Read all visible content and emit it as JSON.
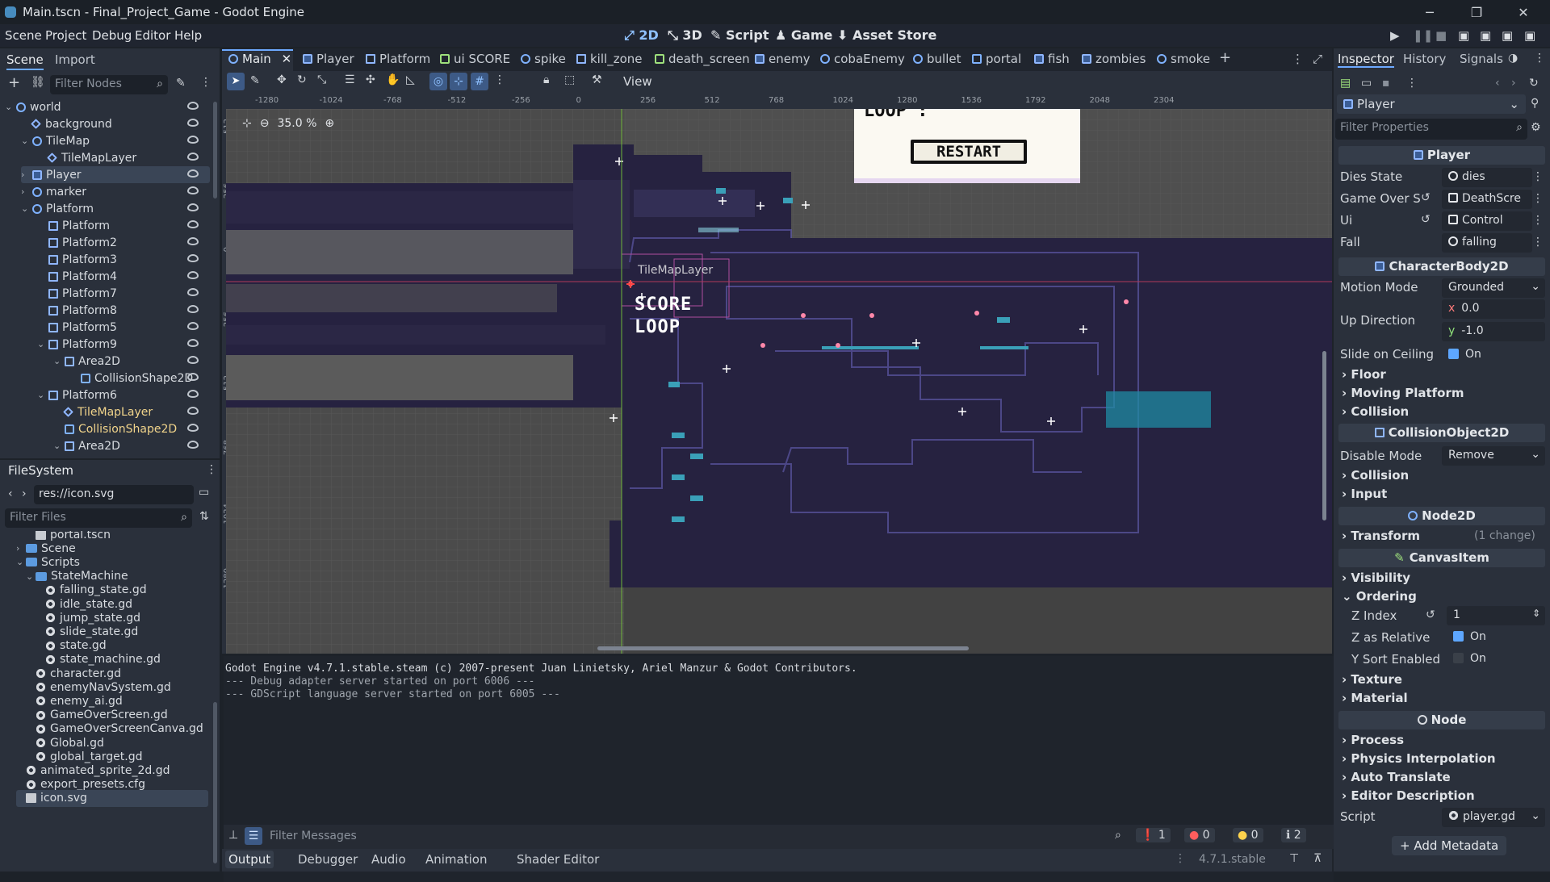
{
  "window": {
    "title": "Main.tscn - Final_Project_Game - Godot Engine"
  },
  "menus": [
    "Scene",
    "Project",
    "Debug",
    "Editor",
    "Help"
  ],
  "workspaces": [
    "2D",
    "3D",
    "Script",
    "Game",
    "Asset Store"
  ],
  "scene_dock": {
    "tabs": [
      "Scene",
      "Import"
    ],
    "filter_placeholder": "Filter Nodes",
    "nodes": [
      {
        "label": "world",
        "depth": 0,
        "icon": "node2d",
        "arrow": "v"
      },
      {
        "label": "background",
        "depth": 1,
        "icon": "tile"
      },
      {
        "label": "TileMap",
        "depth": 1,
        "icon": "node2d",
        "arrow": "v"
      },
      {
        "label": "TileMapLayer",
        "depth": 2,
        "icon": "tile"
      },
      {
        "label": "Player",
        "depth": 1,
        "icon": "char",
        "arrow": ">",
        "selected": true
      },
      {
        "label": "marker",
        "depth": 1,
        "icon": "node2d",
        "arrow": ">"
      },
      {
        "label": "Platform",
        "depth": 1,
        "icon": "node2d",
        "arrow": "v"
      },
      {
        "label": "Platform",
        "depth": 2,
        "icon": "area"
      },
      {
        "label": "Platform2",
        "depth": 2,
        "icon": "area"
      },
      {
        "label": "Platform3",
        "depth": 2,
        "icon": "area"
      },
      {
        "label": "Platform4",
        "depth": 2,
        "icon": "area"
      },
      {
        "label": "Platform7",
        "depth": 2,
        "icon": "area"
      },
      {
        "label": "Platform8",
        "depth": 2,
        "icon": "area"
      },
      {
        "label": "Platform5",
        "depth": 2,
        "icon": "area"
      },
      {
        "label": "Platform9",
        "depth": 2,
        "icon": "area",
        "arrow": "v"
      },
      {
        "label": "Area2D",
        "depth": 3,
        "icon": "area",
        "arrow": "v"
      },
      {
        "label": "CollisionShape2D",
        "depth": 4,
        "icon": "sq"
      },
      {
        "label": "Platform6",
        "depth": 2,
        "icon": "area",
        "arrow": "v"
      },
      {
        "label": "TileMapLayer",
        "depth": 3,
        "icon": "tile",
        "yellow": true
      },
      {
        "label": "CollisionShape2D",
        "depth": 3,
        "icon": "sq",
        "yellow": true
      },
      {
        "label": "Area2D",
        "depth": 3,
        "icon": "area",
        "arrow": "v"
      }
    ]
  },
  "filesystem": {
    "title": "FileSystem",
    "path": "res://icon.svg",
    "filter_placeholder": "Filter Files",
    "items": [
      {
        "label": "portal.tscn",
        "depth": 2,
        "icon": "scn"
      },
      {
        "label": "Scene",
        "depth": 1,
        "icon": "folder",
        "arrow": ">"
      },
      {
        "label": "Scripts",
        "depth": 1,
        "icon": "folder",
        "arrow": "v"
      },
      {
        "label": "StateMachine",
        "depth": 2,
        "icon": "folder",
        "arrow": "v"
      },
      {
        "label": "falling_state.gd",
        "depth": 3,
        "icon": "gear"
      },
      {
        "label": "idle_state.gd",
        "depth": 3,
        "icon": "gear"
      },
      {
        "label": "jump_state.gd",
        "depth": 3,
        "icon": "gear"
      },
      {
        "label": "slide_state.gd",
        "depth": 3,
        "icon": "gear"
      },
      {
        "label": "state.gd",
        "depth": 3,
        "icon": "gear"
      },
      {
        "label": "state_machine.gd",
        "depth": 3,
        "icon": "gear"
      },
      {
        "label": "character.gd",
        "depth": 2,
        "icon": "gear"
      },
      {
        "label": "enemyNavSystem.gd",
        "depth": 2,
        "icon": "gear"
      },
      {
        "label": "enemy_ai.gd",
        "depth": 2,
        "icon": "gear"
      },
      {
        "label": "GameOverScreen.gd",
        "depth": 2,
        "icon": "gear"
      },
      {
        "label": "GameOverScreenCanva.gd",
        "depth": 2,
        "icon": "gear"
      },
      {
        "label": "Global.gd",
        "depth": 2,
        "icon": "gear"
      },
      {
        "label": "global_target.gd",
        "depth": 2,
        "icon": "gear"
      },
      {
        "label": "animated_sprite_2d.gd",
        "depth": 1,
        "icon": "gear"
      },
      {
        "label": "export_presets.cfg",
        "depth": 1,
        "icon": "gear"
      },
      {
        "label": "icon.svg",
        "depth": 1,
        "icon": "scn",
        "selected": true
      }
    ]
  },
  "scene_tabs": [
    "Main",
    "Player",
    "Platform",
    "ui SCORE",
    "spike",
    "kill_zone",
    "death_screen",
    "enemy",
    "cobaEnemy",
    "bullet",
    "portal",
    "fish",
    "zombies",
    "smoke"
  ],
  "toolbar": {
    "view_label": "View",
    "zoom": "35.0 %"
  },
  "ruler_ticks": [
    "-1280",
    "-1024",
    "-768",
    "-512",
    "-256",
    "0",
    "256",
    "512",
    "768",
    "1024",
    "1280",
    "1536",
    "1792",
    "2048",
    "2304"
  ],
  "ruler_vticks": [
    "-512",
    "-256",
    "0",
    "256",
    "512",
    "768",
    "1024",
    "1280"
  ],
  "canvas": {
    "tilemap_label": "TileMapLayer",
    "score_label": "SCORE",
    "loop_label": "LOOP",
    "loop_top": "LOOP :",
    "restart_label": "RESTART"
  },
  "console": {
    "lines": [
      "Godot Engine v4.7.1.stable.steam (c) 2007-present Juan Linietsky, Ariel Manzur & Godot Contributors.",
      "--- Debug adapter server started on port 6006 ---",
      "--- GDScript language server started on port 6005 ---"
    ],
    "filter_placeholder": "Filter Messages",
    "counts": [
      "1",
      "0",
      "0",
      "2"
    ]
  },
  "bottom_tabs": [
    "Output",
    "Debugger",
    "Audio",
    "Animation",
    "Shader Editor"
  ],
  "version": "4.7.1.stable",
  "inspector": {
    "tabs": [
      "Inspector",
      "History",
      "Signals"
    ],
    "node": "Player",
    "filter_placeholder": "Filter Properties",
    "header_player": "Player",
    "props_player": [
      {
        "name": "Dies State",
        "value": "dies"
      },
      {
        "name": "Game Over S",
        "value": "DeathScre"
      },
      {
        "name": "Ui",
        "value": "Control"
      },
      {
        "name": "Fall",
        "value": "falling"
      }
    ],
    "header_char": "CharacterBody2D",
    "motion_mode": {
      "name": "Motion Mode",
      "value": "Grounded"
    },
    "up_direction": {
      "name": "Up Direction",
      "x": "0.0",
      "y": "-1.0",
      "xl": "x",
      "yl": "y"
    },
    "slide_ceiling": {
      "name": "Slide on Ceiling",
      "value": "On"
    },
    "sections1": [
      "Floor",
      "Moving Platform",
      "Collision"
    ],
    "header_col": "CollisionObject2D",
    "disable_mode": {
      "name": "Disable Mode",
      "value": "Remove"
    },
    "sections2": [
      "Collision",
      "Input"
    ],
    "header_node2d": "Node2D",
    "transform": {
      "name": "Transform",
      "note": "(1 change)"
    },
    "header_canvas": "CanvasItem",
    "sections3": [
      "Visibility",
      "Ordering"
    ],
    "z_index": {
      "name": "Z Index",
      "value": "1"
    },
    "z_relative": {
      "name": "Z as Relative",
      "value": "On"
    },
    "ysort": {
      "name": "Y Sort Enabled",
      "value": "On"
    },
    "sections4": [
      "Texture",
      "Material"
    ],
    "header_node": "Node",
    "sections5": [
      "Process",
      "Physics Interpolation",
      "Auto Translate",
      "Editor Description"
    ],
    "script": {
      "name": "Script",
      "value": "player.gd"
    },
    "add_metadata": "Add Metadata"
  }
}
